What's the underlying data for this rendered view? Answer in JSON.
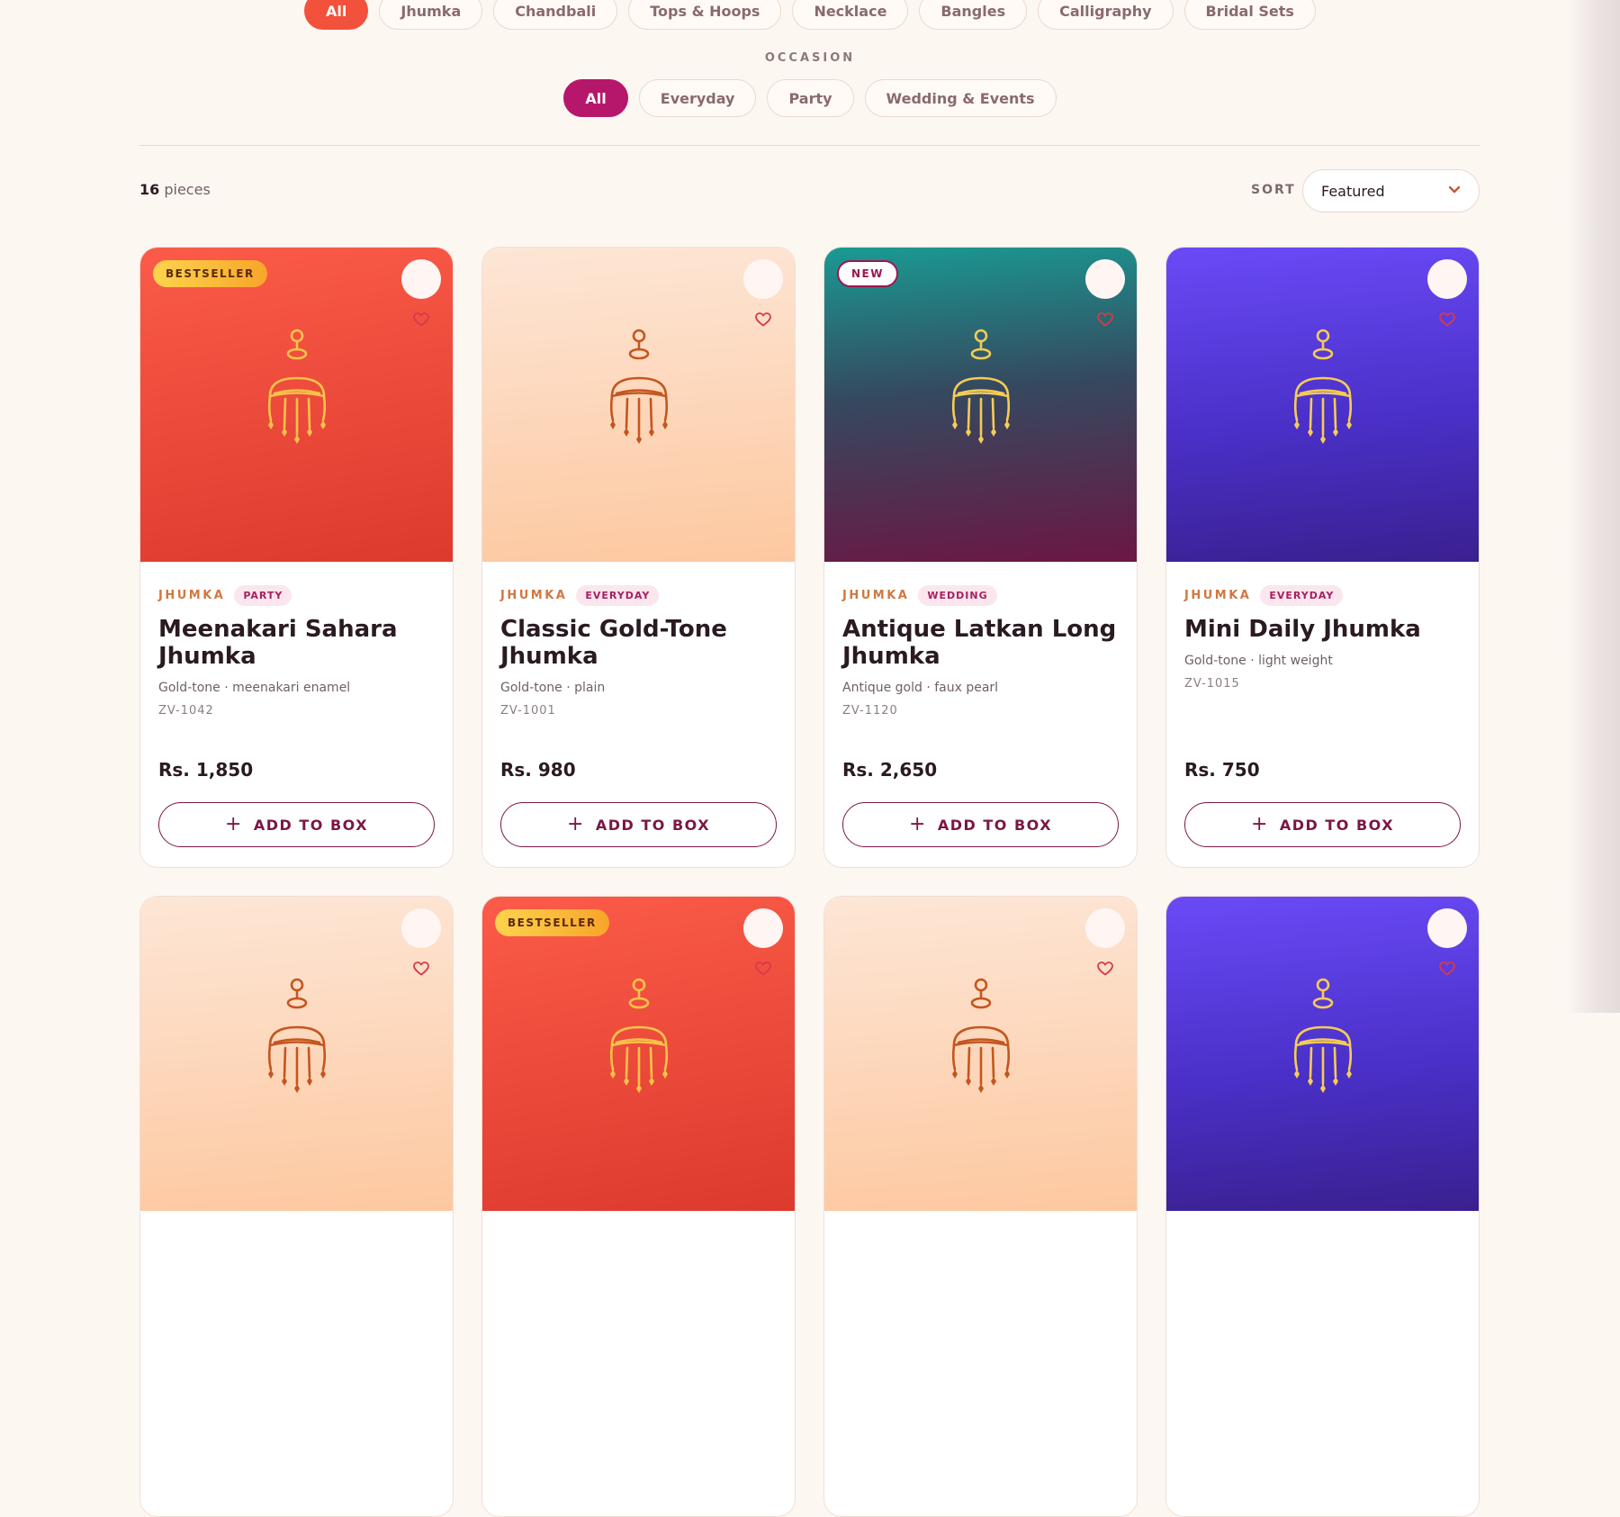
{
  "type_filters": [
    "All",
    "Jhumka",
    "Chandbali",
    "Tops & Hoops",
    "Necklace",
    "Bangles",
    "Calligraphy",
    "Bridal Sets"
  ],
  "occasion": {
    "label": "OCCASION",
    "options": [
      "All",
      "Everyday",
      "Party",
      "Wedding & Events"
    ]
  },
  "results": {
    "count": "16",
    "unit": "pieces"
  },
  "sort": {
    "label": "SORT",
    "value": "Featured"
  },
  "colors": {
    "accent_orange": "#f2513b",
    "accent_magenta": "#b7176a",
    "button_border": "#7a1744"
  },
  "products": [
    {
      "badge": "BESTSELLER",
      "category": "JHUMKA",
      "occasion": "PARTY",
      "title": "Meenakari Sahara Jhumka",
      "desc": "Gold-tone · meenakari enamel",
      "sku": "ZV-1042",
      "price": "Rs. 1,850",
      "button": "ADD TO BOX",
      "theme": "red"
    },
    {
      "badge": "",
      "category": "JHUMKA",
      "occasion": "EVERYDAY",
      "title": "Classic Gold-Tone Jhumka",
      "desc": "Gold-tone · plain",
      "sku": "ZV-1001",
      "price": "Rs. 980",
      "button": "ADD TO BOX",
      "theme": "peach"
    },
    {
      "badge": "NEW",
      "category": "JHUMKA",
      "occasion": "WEDDING",
      "title": "Antique Latkan Long Jhumka",
      "desc": "Antique gold · faux pearl",
      "sku": "ZV-1120",
      "price": "Rs. 2,650",
      "button": "ADD TO BOX",
      "theme": "teal"
    },
    {
      "badge": "",
      "category": "JHUMKA",
      "occasion": "EVERYDAY",
      "title": "Mini Daily Jhumka",
      "desc": "Gold-tone · light weight",
      "sku": "ZV-1015",
      "price": "Rs. 750",
      "button": "ADD TO BOX",
      "theme": "violet"
    },
    {
      "badge": "",
      "theme": "peach"
    },
    {
      "badge": "BESTSELLER",
      "theme": "red"
    },
    {
      "badge": "",
      "theme": "peach"
    },
    {
      "badge": "",
      "theme": "violet"
    }
  ],
  "icons": {
    "heart": "heart-icon",
    "chevron": "chevron-down-icon",
    "plus": "plus-icon",
    "jhumka": "jhumka-icon"
  }
}
